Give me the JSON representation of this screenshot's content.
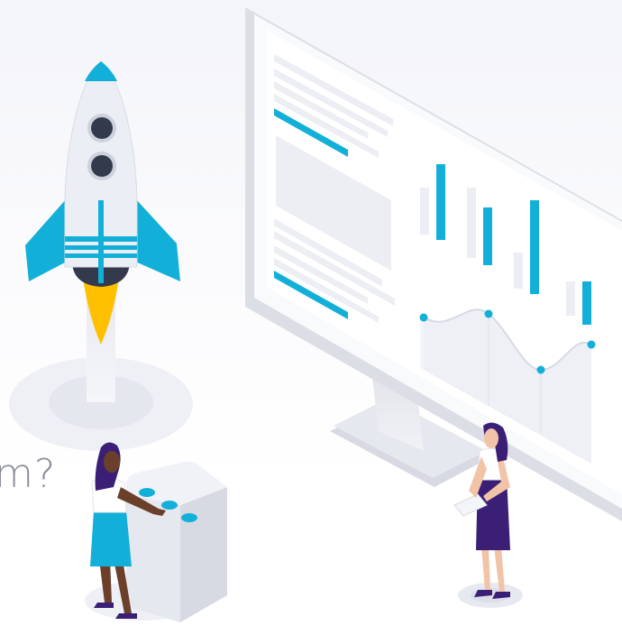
{
  "headline": {
    "partial_text": "m?"
  },
  "illustration": {
    "accent_color": "#12b0d8",
    "flame_color": "#ffc000",
    "ink_color": "#333a4c",
    "purple_color": "#3b1f76",
    "surface_color": "#eceef4",
    "icons": [
      "rocket-icon",
      "monitor-icon",
      "bar-chart-icon",
      "line-chart-icon",
      "person-icon",
      "control-panel-icon"
    ]
  }
}
